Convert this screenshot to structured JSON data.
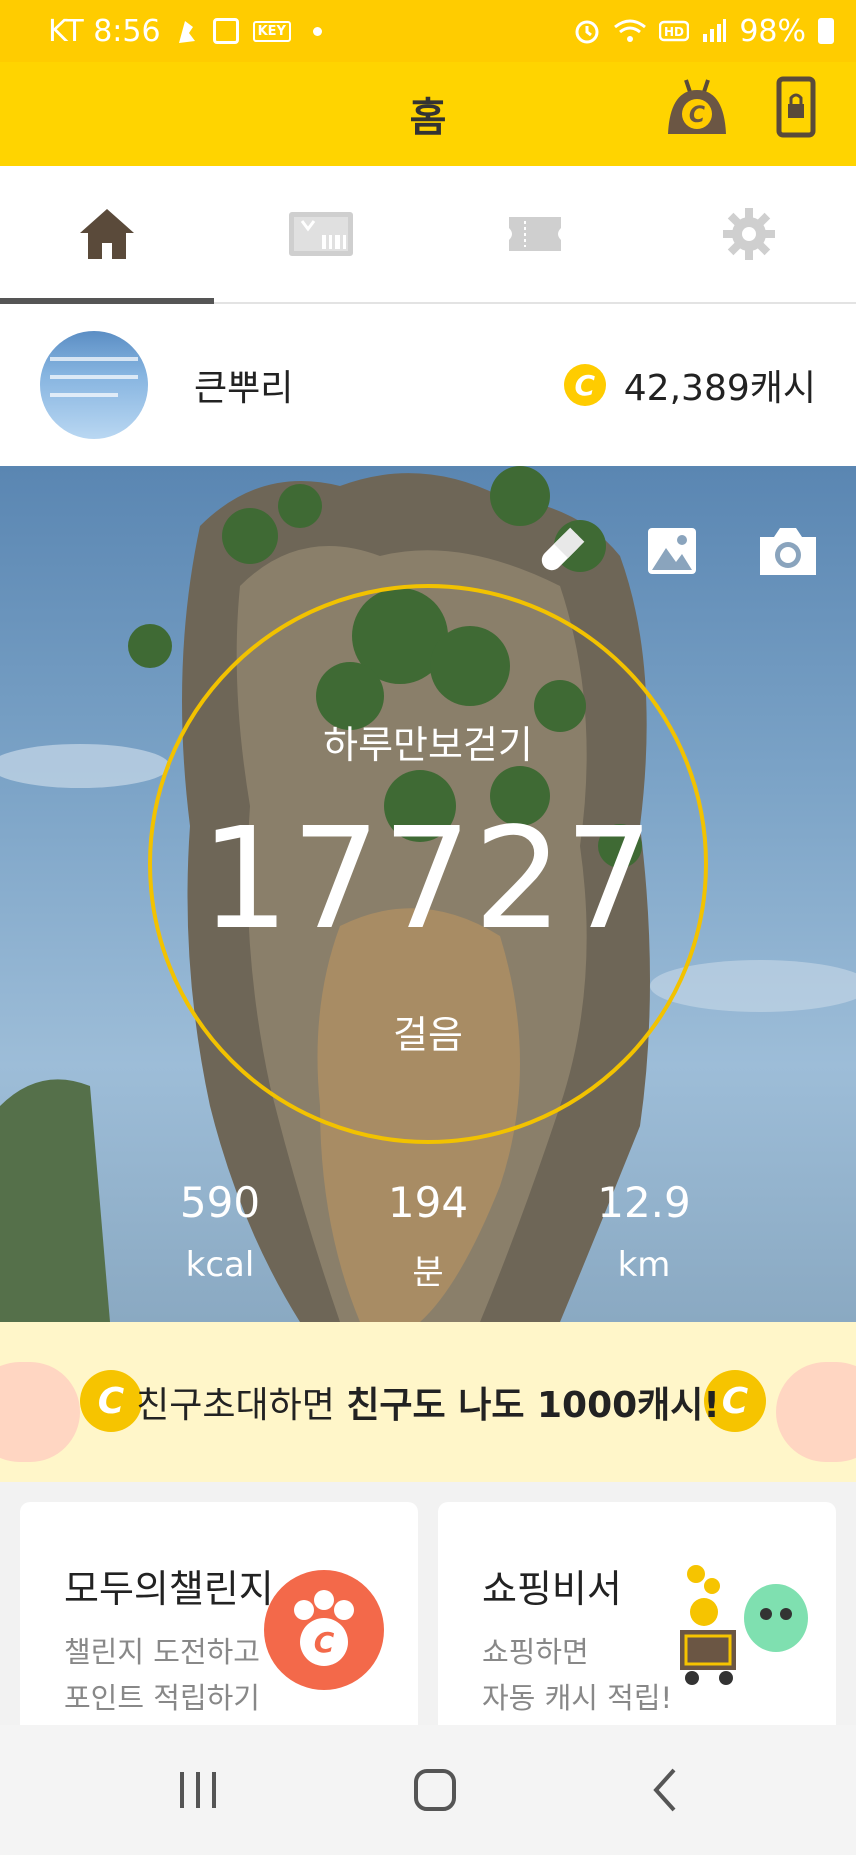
{
  "status_bar": {
    "carrier_time": "KT 8:56",
    "notif_key": "KEY",
    "battery": "98%"
  },
  "app_bar": {
    "title": "홈"
  },
  "tabs": [
    {
      "name": "home-icon",
      "active": true
    },
    {
      "name": "gift-card-icon",
      "active": false
    },
    {
      "name": "ticket-icon",
      "active": false
    },
    {
      "name": "gear-icon",
      "active": false
    }
  ],
  "profile": {
    "nickname": "큰뿌리",
    "coin_symbol": "C",
    "cash": "42,389캐시"
  },
  "pedometer": {
    "label": "하루만보걷기",
    "steps": "17727",
    "unit": "걸음",
    "stats": [
      {
        "value": "590",
        "unit": "kcal"
      },
      {
        "value": "194",
        "unit": "분"
      },
      {
        "value": "12.9",
        "unit": "km"
      }
    ]
  },
  "banner": {
    "text_normal": "친구초대하면 ",
    "text_bold": "친구도 나도 1000캐시!",
    "coin_symbol": "C"
  },
  "cards": [
    {
      "title": "모두의챌린지",
      "line1": "챌린지 도전하고",
      "line2": "포인트 적립하기"
    },
    {
      "title": "쇼핑비서",
      "line1": "쇼핑하면",
      "line2": "자동 캐시 적립!"
    }
  ],
  "colors": {
    "brand_yellow": "#ffd400",
    "ring": "#f2c200",
    "coin": "#ffcc00",
    "paw": "#f3694a"
  }
}
